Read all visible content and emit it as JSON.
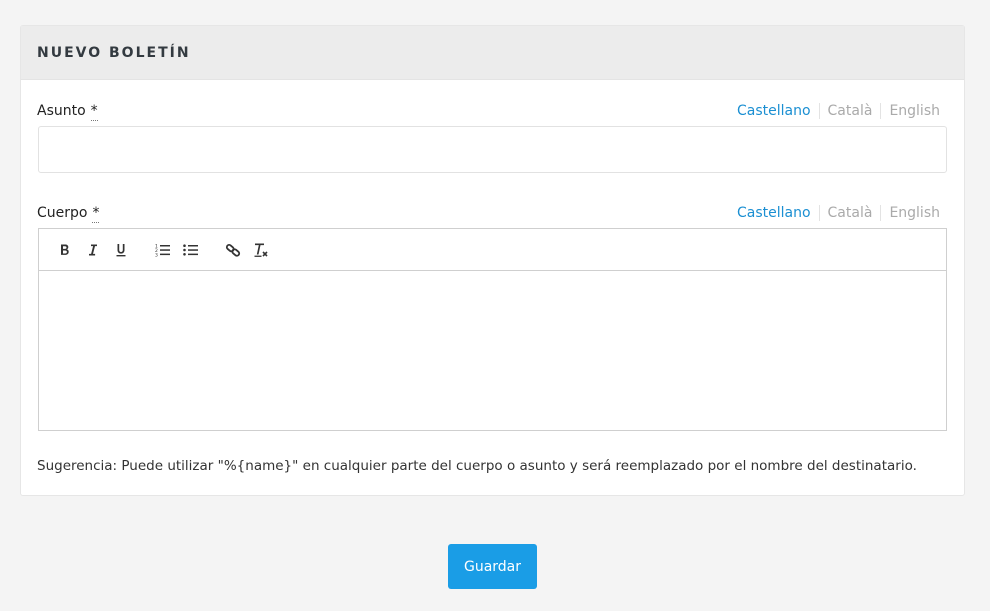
{
  "panel": {
    "title": "NUEVO BOLETÍN"
  },
  "subject": {
    "label": "Asunto",
    "required_mark": "*",
    "value": "",
    "languages": [
      "Castellano",
      "Català",
      "English"
    ],
    "active_language": "Castellano"
  },
  "body": {
    "label": "Cuerpo",
    "required_mark": "*",
    "languages": [
      "Castellano",
      "Català",
      "English"
    ],
    "active_language": "Castellano",
    "toolbar": [
      "bold-icon",
      "italic-icon",
      "underline-icon",
      "ordered-list-icon",
      "bullet-list-icon",
      "link-icon",
      "clear-format-icon"
    ],
    "content": ""
  },
  "hint": "Sugerencia: Puede utilizar \"%{name}\" en cualquier parte del cuerpo o asunto y será reemplazado por el nombre del destinatario.",
  "actions": {
    "save_label": "Guardar"
  },
  "colors": {
    "accent": "#1a9de6",
    "active_language": "#1b8fd2"
  }
}
